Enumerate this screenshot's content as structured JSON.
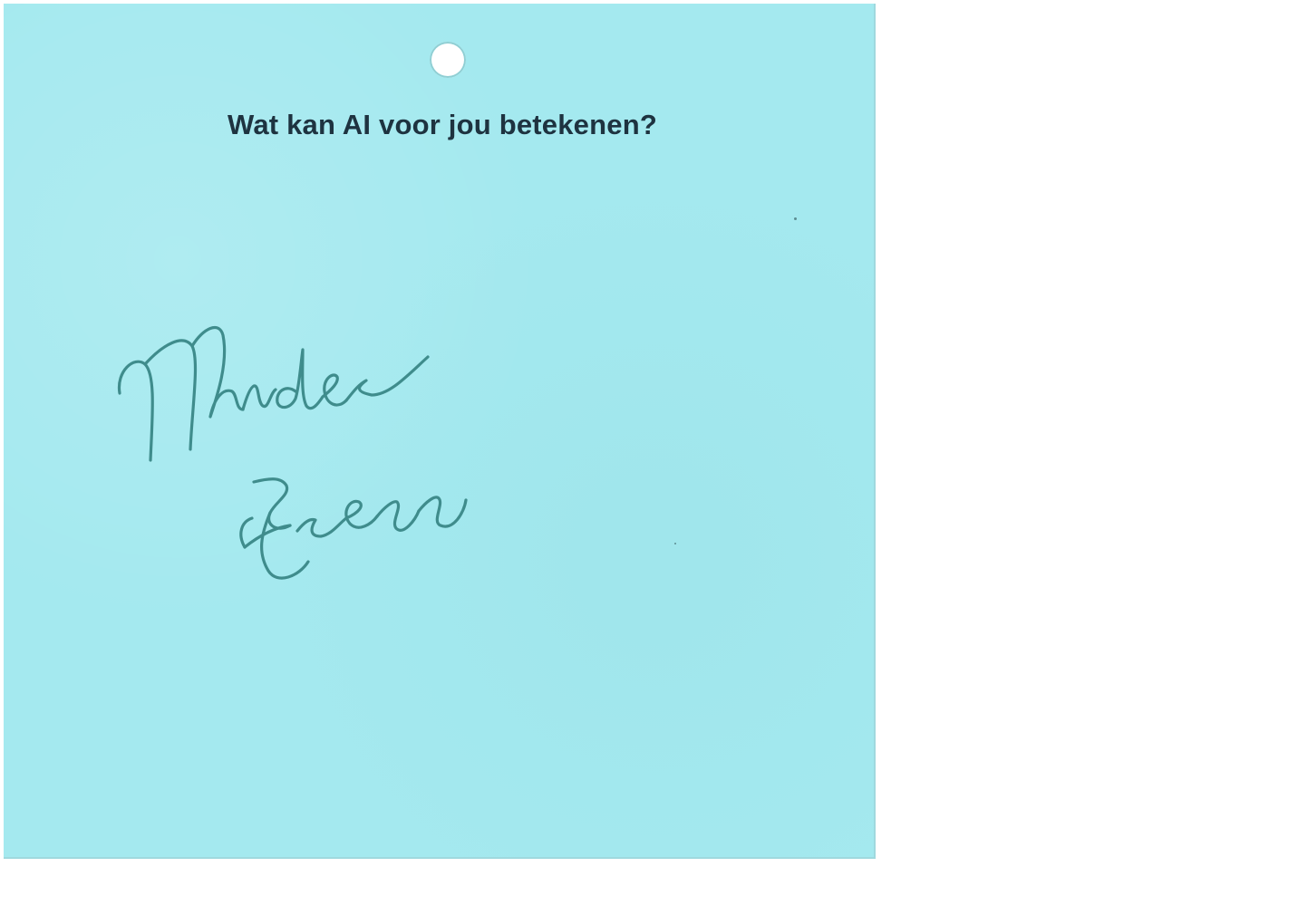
{
  "card": {
    "question": "Wat kan AI voor jou betekenen?",
    "answer_line_1": "Minder",
    "answer_line_2": "stress",
    "background_color": "#a4e9ef",
    "ink_color": "#3f8c8c",
    "title_color": "#1e3340"
  }
}
